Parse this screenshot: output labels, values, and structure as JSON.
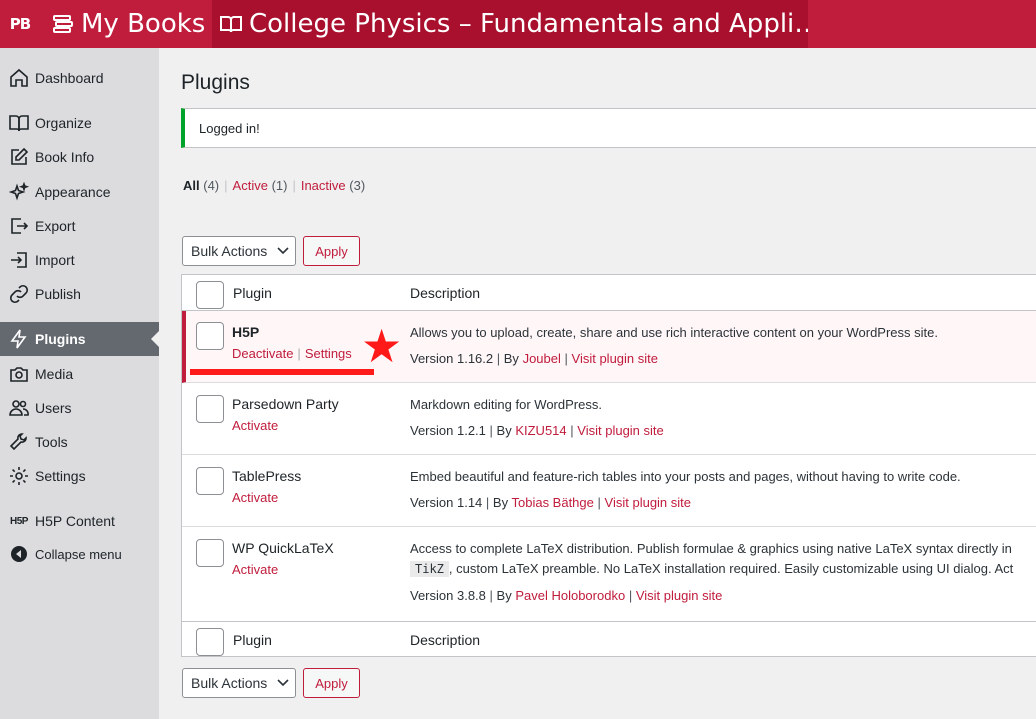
{
  "topbar": {
    "logo": "PB",
    "my_books": "My Books",
    "book_title": "College Physics – Fundamentals and Appli…",
    "color": "#c01c3c"
  },
  "sidebar": {
    "items": [
      {
        "label": "Dashboard",
        "icon": "home-icon"
      },
      {
        "label": "Organize",
        "icon": "book-open-icon"
      },
      {
        "label": "Book Info",
        "icon": "edit-icon"
      },
      {
        "label": "Appearance",
        "icon": "sparkle-icon"
      },
      {
        "label": "Export",
        "icon": "export-icon"
      },
      {
        "label": "Import",
        "icon": "import-icon"
      },
      {
        "label": "Publish",
        "icon": "link-icon"
      },
      {
        "label": "Plugins",
        "icon": "plugins-bolt-icon",
        "active": true
      },
      {
        "label": "Media",
        "icon": "camera-icon"
      },
      {
        "label": "Users",
        "icon": "users-icon"
      },
      {
        "label": "Tools",
        "icon": "wrench-icon"
      },
      {
        "label": "Settings",
        "icon": "gear-icon"
      },
      {
        "label": "H5P Content",
        "icon": "h5p-icon"
      },
      {
        "label": "Collapse menu",
        "icon": "collapse-icon"
      }
    ]
  },
  "main": {
    "title": "Plugins",
    "notice": "Logged in!",
    "filters": {
      "all": "All",
      "all_count": "(4)",
      "active": "Active",
      "active_count": "(1)",
      "inactive": "Inactive",
      "inactive_count": "(3)"
    },
    "bulk_actions": "Bulk Actions",
    "apply": "Apply",
    "table": {
      "col_plugin": "Plugin",
      "col_description": "Description",
      "sep": "|",
      "by": "By",
      "plugins": [
        {
          "name": "H5P",
          "action_1": "Deactivate",
          "action_2": "Settings",
          "description": "Allows you to upload, create, share and use rich interactive content on your WordPress site.",
          "version": "Version 1.16.2",
          "author": "Joubel",
          "visit": "Visit plugin site"
        },
        {
          "name": "Parsedown Party",
          "action_1": "Activate",
          "description": "Markdown editing for WordPress.",
          "version": "Version 1.2.1",
          "author": "KIZU514",
          "visit": "Visit plugin site"
        },
        {
          "name": "TablePress",
          "action_1": "Activate",
          "description": "Embed beautiful and feature-rich tables into your posts and pages, without having to write code.",
          "version": "Version 1.14",
          "author": "Tobias Bäthge",
          "visit": "Visit plugin site"
        },
        {
          "name": "WP QuickLaTeX",
          "action_1": "Activate",
          "description": "Access to complete LaTeX distribution. Publish formulae & graphics using native LaTeX syntax directly in",
          "description_code": "TikZ",
          "description_2": ", custom LaTeX preamble. No LaTeX installation required. Easily customizable using UI dialog. Act",
          "version": "Version 3.8.8",
          "author": "Pavel Holoborodko",
          "visit": "Visit plugin site"
        }
      ]
    },
    "annotation": {
      "marker": "★",
      "color": "#ff1a1a"
    }
  }
}
